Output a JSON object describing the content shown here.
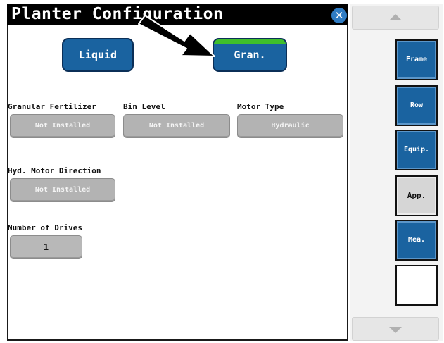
{
  "title_bar": {
    "title": "Planter Configuration",
    "close_glyph": "✕"
  },
  "mode_buttons": {
    "liquid_label": "Liquid",
    "granular_label": "Gran.",
    "granular_selected": true,
    "selected_indicator_color": "#3fbf2c"
  },
  "fields": {
    "granular_fertilizer": {
      "label": "Granular Fertilizer",
      "value": "Not Installed"
    },
    "bin_level": {
      "label": "Bin Level",
      "value": "Not Installed"
    },
    "motor_type": {
      "label": "Motor Type",
      "value": "Hydraulic"
    },
    "hyd_motor_direction": {
      "label": "Hyd. Motor Direction",
      "value": "Not Installed"
    },
    "number_of_drives": {
      "label": "Number of Drives",
      "value": "1"
    }
  },
  "side_nav": {
    "scroll_up_icon": "triangle-up-icon",
    "scroll_down_icon": "triangle-down-icon",
    "tabs": [
      {
        "label": "Frame",
        "state": "blue"
      },
      {
        "label": "Row",
        "state": "blue"
      },
      {
        "label": "Equip.",
        "state": "blue"
      },
      {
        "label": "App.",
        "state": "active-grey"
      },
      {
        "label": "Mea.",
        "state": "blue"
      },
      {
        "label": "",
        "state": "blank"
      }
    ]
  },
  "colors": {
    "button_blue": "#1a63a0",
    "title_bg": "#000000",
    "field_grey": "#b3b3b3",
    "close_blue": "#2f7cc4"
  }
}
